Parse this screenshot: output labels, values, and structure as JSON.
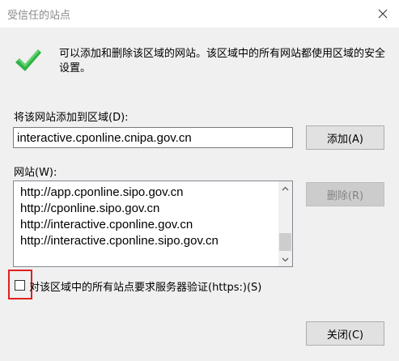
{
  "window": {
    "title": "受信任的站点"
  },
  "info": {
    "description": "可以添加和删除该区域的网站。该区域中的所有网站都使用区域的安全设置。"
  },
  "add_section": {
    "label": "将该网站添加到区域(D):",
    "input_value": "interactive.cponline.cnipa.gov.cn",
    "add_button": "添加(A)"
  },
  "sites_section": {
    "label": "网站(W):",
    "items": [
      "http://app.cponline.sipo.gov.cn",
      "http://cponline.sipo.gov.cn",
      "http://interactive.cponline.gov.cn",
      "http://interactive.cponline.sipo.gov.cn"
    ],
    "remove_button": "删除(R)"
  },
  "https_checkbox": {
    "label": "对该区域中的所有站点要求服务器验证(https:)(S)",
    "checked": false
  },
  "footer": {
    "close_button": "关闭(C)"
  },
  "colors": {
    "check": "#2fb344",
    "highlight": "#e02020"
  }
}
